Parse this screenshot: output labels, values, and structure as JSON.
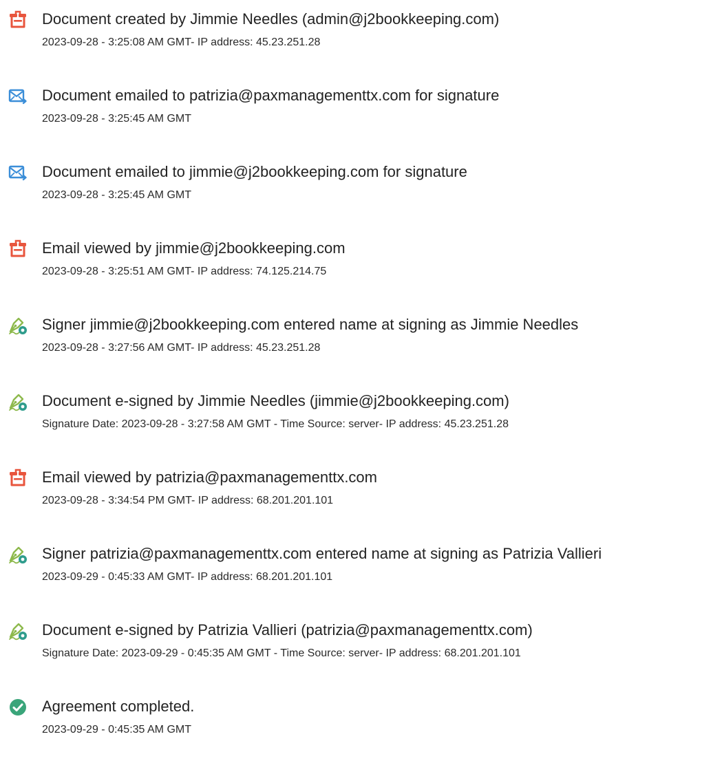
{
  "colors": {
    "document_icon": "#e8553d",
    "email_icon": "#3b8ed8",
    "signature_icon": "#8db94c",
    "signature_badge": "#2f9c8c",
    "complete_icon": "#3aa57a"
  },
  "events": [
    {
      "icon": "document-icon",
      "title": "Document created by Jimmie Needles (admin@j2bookkeeping.com)",
      "detail": "2023-09-28 - 3:25:08 AM GMT- IP address: 45.23.251.28"
    },
    {
      "icon": "email-sent-icon",
      "title": "Document emailed to patrizia@paxmanagementtx.com for signature",
      "detail": "2023-09-28 - 3:25:45 AM GMT"
    },
    {
      "icon": "email-sent-icon",
      "title": "Document emailed to jimmie@j2bookkeeping.com for signature",
      "detail": "2023-09-28 - 3:25:45 AM GMT"
    },
    {
      "icon": "document-icon",
      "title": "Email viewed by jimmie@j2bookkeeping.com",
      "detail": "2023-09-28 - 3:25:51 AM GMT- IP address: 74.125.214.75"
    },
    {
      "icon": "signature-pen-icon",
      "title": "Signer jimmie@j2bookkeeping.com entered name at signing as Jimmie Needles",
      "detail": "2023-09-28 - 3:27:56 AM GMT- IP address: 45.23.251.28"
    },
    {
      "icon": "signature-pen-icon",
      "title": "Document e-signed by Jimmie Needles (jimmie@j2bookkeeping.com)",
      "detail": "Signature Date: 2023-09-28 - 3:27:58 AM GMT - Time Source: server- IP address: 45.23.251.28"
    },
    {
      "icon": "document-icon",
      "title": "Email viewed by patrizia@paxmanagementtx.com",
      "detail": "2023-09-28 - 3:34:54 PM GMT- IP address: 68.201.201.101"
    },
    {
      "icon": "signature-pen-icon",
      "title": "Signer patrizia@paxmanagementtx.com entered name at signing as Patrizia Vallieri",
      "detail": "2023-09-29 - 0:45:33 AM GMT- IP address: 68.201.201.101"
    },
    {
      "icon": "signature-pen-icon",
      "title": "Document e-signed by Patrizia Vallieri (patrizia@paxmanagementtx.com)",
      "detail": "Signature Date: 2023-09-29 - 0:45:35 AM GMT - Time Source: server- IP address: 68.201.201.101"
    },
    {
      "icon": "checkmark-circle-icon",
      "title": "Agreement completed.",
      "detail": "2023-09-29 - 0:45:35 AM GMT"
    }
  ]
}
